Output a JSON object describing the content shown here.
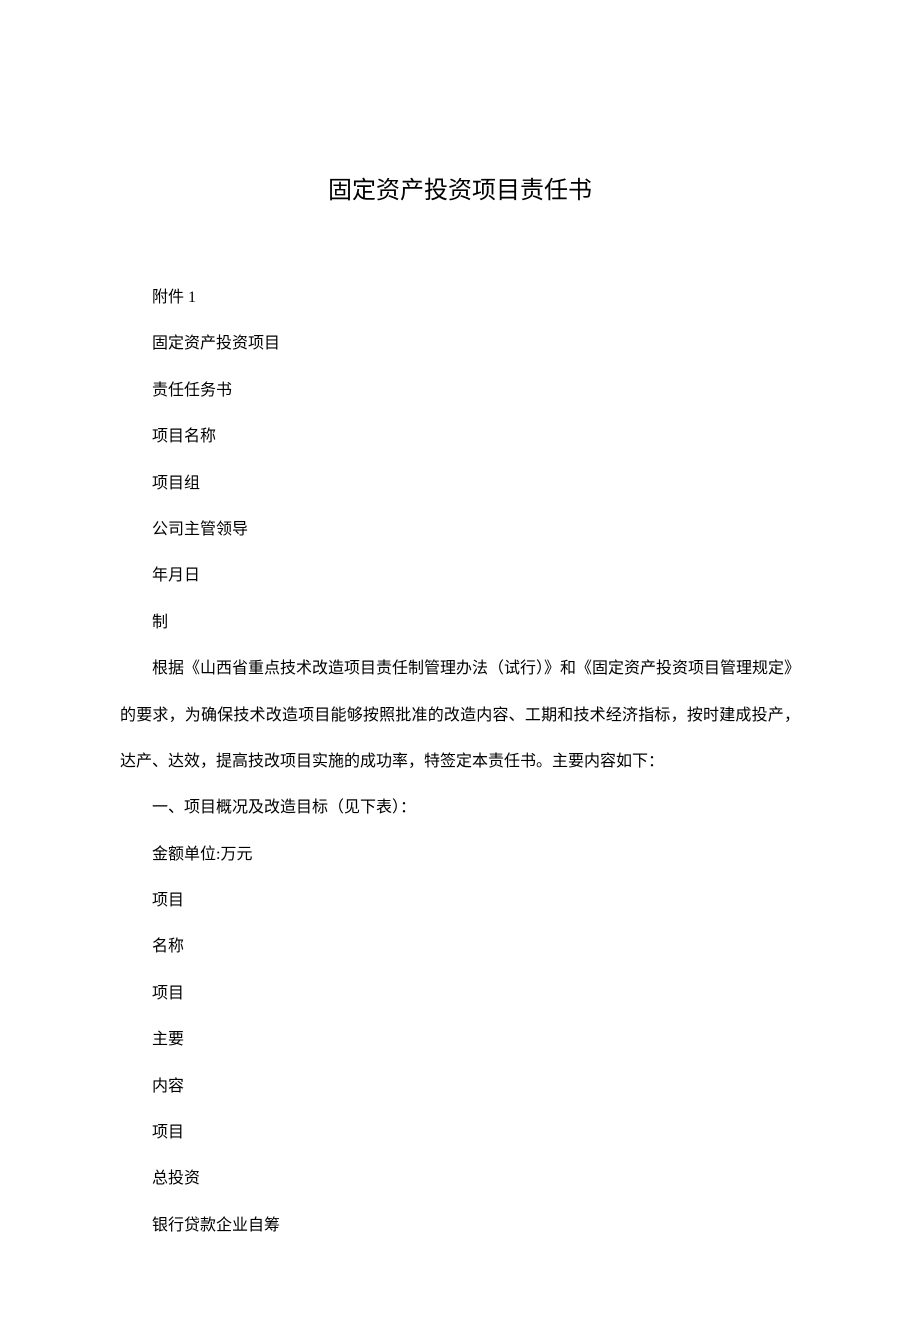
{
  "title": "固定资产投资项目责任书",
  "lines": {
    "attachment": "附件 1",
    "line1": "固定资产投资项目",
    "line2": "责任任务书",
    "line3": "项目名称",
    "line4": "项目组",
    "line5": "公司主管领导",
    "line6": "年月日",
    "line7": "制",
    "body": "根据《山西省重点技术改造项目责任制管理办法（试行）》和《固定资产投资项目管理规定》的要求，为确保技术改造项目能够按照批准的改造内容、工期和技术经济指标，按时建成投产，达产、达效，提高技改项目实施的成功率，特签定本责任书。主要内容如下：",
    "section1": "一、项目概况及改造目标（见下表）：",
    "unit": "金额单位:万元",
    "item1": "项目",
    "item2": "名称",
    "item3": "项目",
    "item4": "主要",
    "item5": "内容",
    "item6": "项目",
    "item7": "总投资",
    "item8": "银行贷款企业自筹"
  }
}
